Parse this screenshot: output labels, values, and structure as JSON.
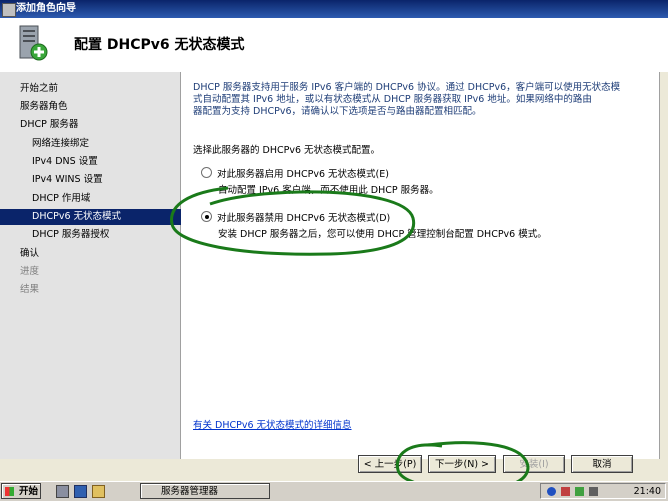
{
  "window": {
    "title": "添加角色向导"
  },
  "header": {
    "page_title": "配置 DHCPv6 无状态模式"
  },
  "sidebar": {
    "items": [
      {
        "label": "开始之前",
        "indent": 0,
        "state": "normal"
      },
      {
        "label": "服务器角色",
        "indent": 0,
        "state": "normal"
      },
      {
        "label": "DHCP 服务器",
        "indent": 0,
        "state": "normal"
      },
      {
        "label": "网络连接绑定",
        "indent": 1,
        "state": "normal"
      },
      {
        "label": "IPv4 DNS 设置",
        "indent": 1,
        "state": "normal"
      },
      {
        "label": "IPv4 WINS 设置",
        "indent": 1,
        "state": "normal"
      },
      {
        "label": "DHCP 作用域",
        "indent": 1,
        "state": "normal"
      },
      {
        "label": "DHCPv6 无状态模式",
        "indent": 1,
        "state": "selected"
      },
      {
        "label": "DHCP 服务器授权",
        "indent": 1,
        "state": "normal"
      },
      {
        "label": "确认",
        "indent": 0,
        "state": "normal"
      },
      {
        "label": "进度",
        "indent": 0,
        "state": "disabled"
      },
      {
        "label": "结果",
        "indent": 0,
        "state": "disabled"
      }
    ]
  },
  "main": {
    "description_line1": "DHCP 服务器支持用于服务 IPv6 客户端的 DHCPv6 协议。通过 DHCPv6，客户端可以使用无状态模",
    "description_line2": "式自动配置其 IPv6 地址，或以有状态模式从 DHCP 服务器获取 IPv6 地址。如果网络中的路由",
    "description_line3": "器配置为支持 DHCPv6，请确认以下选项是否与路由器配置相匹配。",
    "prompt": "选择此服务器的 DHCPv6 无状态模式配置。",
    "option_enable_label": "对此服务器启用 DHCPv6 无状态模式(E)",
    "option_enable_desc": "自动配置 IPv6 客户端，而不使用此 DHCP 服务器。",
    "option_disable_label": "对此服务器禁用 DHCPv6 无状态模式(D)",
    "option_disable_desc": "安装 DHCP 服务器之后，您可以使用 DHCP 管理控制台配置 DHCPv6 模式。",
    "selected_option": "disable",
    "help_link": "有关 DHCPv6 无状态模式的详细信息"
  },
  "buttons": {
    "prev": "< 上一步(P)",
    "next": "下一步(N) >",
    "install": "安装(I)",
    "cancel": "取消"
  },
  "taskbar": {
    "start": "开始",
    "task": "服务器管理器",
    "clock": "21:40"
  },
  "colors": {
    "annotation": "#1a7a1a",
    "selection": "#0a246a",
    "link": "#0033cc"
  }
}
